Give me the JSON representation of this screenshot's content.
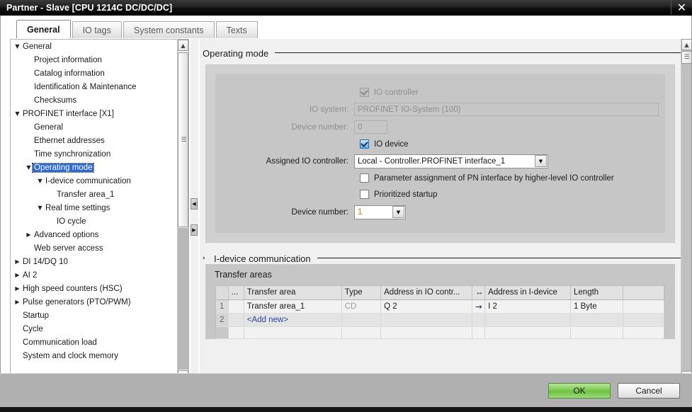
{
  "window": {
    "title": "Partner - Slave [CPU 1214C DC/DC/DC]",
    "close_label": "✕"
  },
  "tabs": [
    {
      "label": "General",
      "active": true
    },
    {
      "label": "IO tags",
      "active": false
    },
    {
      "label": "System constants",
      "active": false
    },
    {
      "label": "Texts",
      "active": false
    }
  ],
  "tree": {
    "items": [
      {
        "label": "General",
        "indent": 0,
        "arrow": "▼",
        "selected": false
      },
      {
        "label": "Project information",
        "indent": 1,
        "arrow": "",
        "selected": false
      },
      {
        "label": "Catalog information",
        "indent": 1,
        "arrow": "",
        "selected": false
      },
      {
        "label": "Identification & Maintenance",
        "indent": 1,
        "arrow": "",
        "selected": false
      },
      {
        "label": "Checksums",
        "indent": 1,
        "arrow": "",
        "selected": false
      },
      {
        "label": "PROFINET interface [X1]",
        "indent": 0,
        "arrow": "▼",
        "selected": false
      },
      {
        "label": "General",
        "indent": 1,
        "arrow": "",
        "selected": false
      },
      {
        "label": "Ethernet addresses",
        "indent": 1,
        "arrow": "",
        "selected": false
      },
      {
        "label": "Time synchronization",
        "indent": 1,
        "arrow": "",
        "selected": false
      },
      {
        "label": "Operating mode",
        "indent": 1,
        "arrow": "▼",
        "selected": true
      },
      {
        "label": "I-device communication",
        "indent": 2,
        "arrow": "▼",
        "selected": false
      },
      {
        "label": "Transfer area_1",
        "indent": 3,
        "arrow": "",
        "selected": false
      },
      {
        "label": "Real time settings",
        "indent": 2,
        "arrow": "▼",
        "selected": false
      },
      {
        "label": "IO cycle",
        "indent": 3,
        "arrow": "",
        "selected": false
      },
      {
        "label": "Advanced options",
        "indent": 1,
        "arrow": "▶",
        "selected": false
      },
      {
        "label": "Web server access",
        "indent": 1,
        "arrow": "",
        "selected": false
      },
      {
        "label": "DI 14/DQ 10",
        "indent": 0,
        "arrow": "▶",
        "selected": false
      },
      {
        "label": "AI 2",
        "indent": 0,
        "arrow": "▶",
        "selected": false
      },
      {
        "label": "High speed counters (HSC)",
        "indent": 0,
        "arrow": "▶",
        "selected": false
      },
      {
        "label": "Pulse generators (PTO/PWM)",
        "indent": 0,
        "arrow": "▶",
        "selected": false
      },
      {
        "label": "Startup",
        "indent": 0,
        "arrow": "",
        "selected": false
      },
      {
        "label": "Cycle",
        "indent": 0,
        "arrow": "",
        "selected": false
      },
      {
        "label": "Communication load",
        "indent": 0,
        "arrow": "",
        "selected": false
      },
      {
        "label": "System and clock memory",
        "indent": 0,
        "arrow": "",
        "selected": false
      }
    ],
    "scrollbar": {
      "up_glyph": "▲",
      "down_glyph": "▼",
      "grip_glyph": "☰"
    }
  },
  "splitter": {
    "left_glyph": "◀",
    "right_glyph": "▶"
  },
  "operating_mode": {
    "section_title": "Operating mode",
    "io_controller": {
      "label": "IO controller",
      "checked": true,
      "enabled": false
    },
    "io_system": {
      "label": "IO system:",
      "value": "PROFINET IO-System (100)",
      "enabled": false
    },
    "device_number_controller": {
      "label": "Device number:",
      "value": "0",
      "enabled": false
    },
    "io_device": {
      "label": "IO device",
      "checked": true,
      "enabled": true
    },
    "assigned_io_controller": {
      "label": "Assigned IO controller:",
      "value": "Local - Controller.PROFINET interface_1"
    },
    "param_assignment": {
      "label": "Parameter assignment of PN interface by higher-level IO controller",
      "checked": false
    },
    "prioritized_startup": {
      "label": "Prioritized startup",
      "checked": false
    },
    "device_number_idevice": {
      "label": "Device number:",
      "value": "1"
    },
    "combo_arrow_glyph": "▼"
  },
  "idevice_communication": {
    "section_title": "I-device communication",
    "expander_glyph": "›"
  },
  "transfer_areas": {
    "title": "Transfer areas",
    "columns": [
      "",
      "...",
      "Transfer area",
      "Type",
      "Address in IO contr...",
      "↔",
      "Address in I-device",
      "Length",
      ""
    ],
    "rows": [
      {
        "index": "1",
        "dots": "",
        "transfer_area": "Transfer area_1",
        "type": "CD",
        "address_io_controller": "Q 2",
        "direction": "→",
        "address_idevice": "I 2",
        "length": "1 Byte",
        "trailing": ""
      },
      {
        "index": "2",
        "dots": "",
        "transfer_area": "<Add new>",
        "type": "",
        "address_io_controller": "",
        "direction": "",
        "address_idevice": "",
        "length": "",
        "trailing": ""
      }
    ]
  },
  "content_scrollbar": {
    "up_glyph": "▲",
    "down_glyph": "▼",
    "thumb_glyph": "☰"
  },
  "footer": {
    "ok_label": "OK",
    "cancel_label": "Cancel"
  },
  "colors": {
    "selection_blue": "#2d6ad4",
    "ok_green": "#6ec241",
    "value_orange": "#d07a10",
    "link_blue": "#2b3fa0"
  }
}
